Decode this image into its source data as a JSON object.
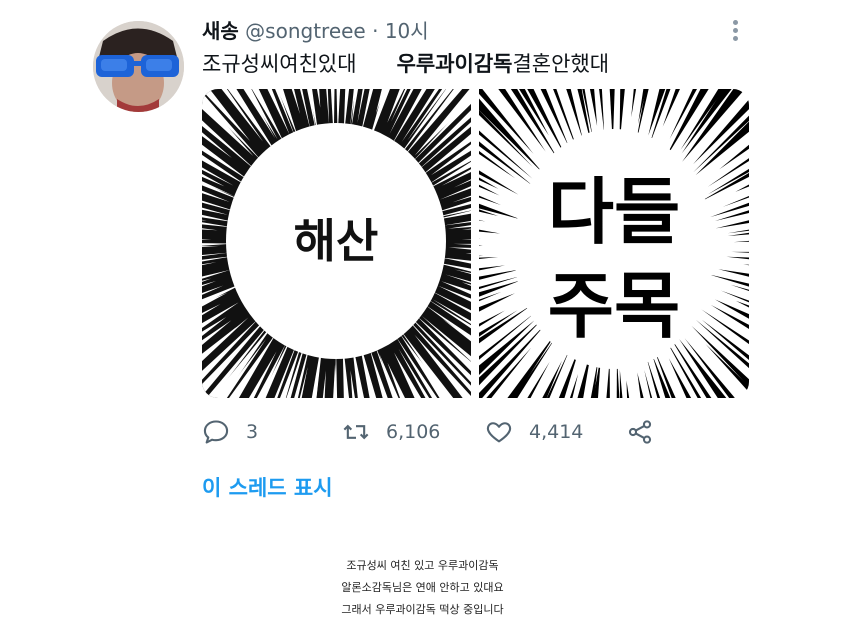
{
  "tweet": {
    "display_name": "새송",
    "handle": "@songtreee",
    "separator": "·",
    "time": "10시",
    "text_part1": "조규성씨여친있대",
    "text_mention": "우루과이감독",
    "text_part2": "결혼안했대",
    "media": {
      "left_panel_text": "해산",
      "right_panel_line1": "다들",
      "right_panel_line2": "주목"
    },
    "actions": {
      "replies": "3",
      "retweets": "6,106",
      "likes": "4,414"
    },
    "show_thread": "이 스레드 표시"
  },
  "caption": {
    "line1": "조규성씨 여친 있고 우루과이감독",
    "line2": "알론소감독님은 연애 안하고 있대요",
    "line3": "그래서 우루과이감독 떡상 중입니다"
  },
  "icons": {
    "more": "more-icon",
    "reply": "reply-icon",
    "retweet": "retweet-icon",
    "like": "heart-icon",
    "share": "share-icon"
  },
  "colors": {
    "link": "#1d9bf0",
    "meta": "#536471",
    "text": "#0f1419"
  }
}
